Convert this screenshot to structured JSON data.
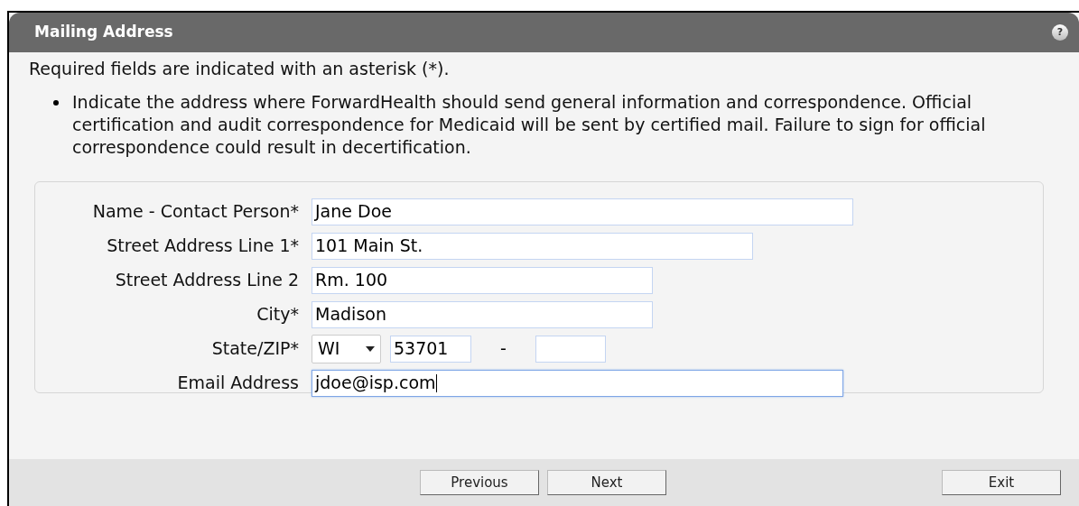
{
  "header": {
    "title": "Mailing Address",
    "help": "?"
  },
  "required_note": "Required fields are indicated with an asterisk (*).",
  "instructions": [
    "Indicate the address where ForwardHealth should send general information and correspondence. Official certification and audit correspondence for Medicaid will be sent by certified mail. Failure to sign for official correspondence could result in decertification."
  ],
  "fields": [
    {
      "kind": "text",
      "label": "Name - Contact Person*",
      "value": "Jane Doe",
      "focused": false
    },
    {
      "kind": "text",
      "label": "Street Address Line 1*",
      "value": "101 Main St.",
      "focused": false
    },
    {
      "kind": "text",
      "label": "Street Address Line 2",
      "value": "Rm. 100",
      "focused": false
    },
    {
      "kind": "text",
      "label": "City*",
      "value": "Madison",
      "focused": false
    },
    {
      "kind": "statezip",
      "label": "State/ZIP*",
      "state": "WI",
      "zip": "53701",
      "separator": "-"
    },
    {
      "kind": "text",
      "label": "Email Address",
      "value": "jdoe@isp.com",
      "focused": true
    }
  ],
  "buttons": [
    {
      "label": "Previous",
      "kind": "nav"
    },
    {
      "label": "Next",
      "kind": "nav"
    },
    {
      "label": "Exit",
      "kind": "exit"
    }
  ]
}
